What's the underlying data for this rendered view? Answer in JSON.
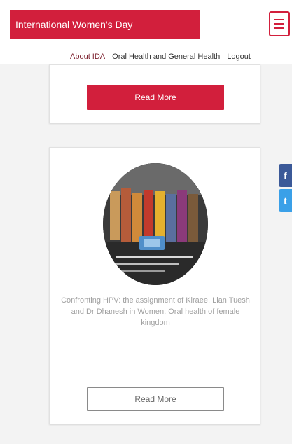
{
  "header": {
    "title": "International Women's Day",
    "brand_color": "#d21f3c",
    "menu_icon": "hamburger-menu-icon"
  },
  "nav": {
    "items": [
      {
        "label": "About IDA"
      },
      {
        "label": "Oral Health and General Health"
      },
      {
        "label": "Logout"
      }
    ]
  },
  "cards": [
    {
      "button_label": "Read More"
    },
    {
      "image": "circular-event-photo",
      "caption": "Confronting HPV: the assignment of Kiraee, Lian Tuesh and Dr Dhanesh in Women: Oral health of female kingdom",
      "button_label": "Read More"
    }
  ],
  "social": {
    "items": [
      {
        "icon": "facebook-icon",
        "glyph": "f",
        "color": "#3b5998"
      },
      {
        "icon": "twitter-icon",
        "glyph": "t",
        "color": "#3aa0e8"
      }
    ]
  }
}
